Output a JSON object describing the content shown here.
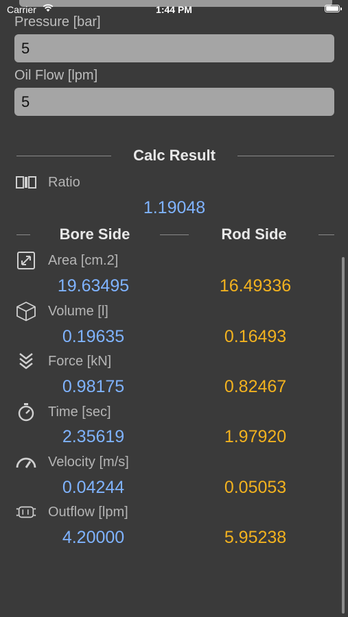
{
  "status": {
    "carrier": "Carrier",
    "time": "1:44 PM"
  },
  "inputs": {
    "pressure_label": "Pressure [bar]",
    "pressure_value": "5",
    "oilflow_label": "Oil Flow [lpm]",
    "oilflow_value": "5"
  },
  "result": {
    "title": "Calc Result",
    "ratio_label": "Ratio",
    "ratio_value": "1.19048",
    "bore_header": "Bore Side",
    "rod_header": "Rod Side"
  },
  "rows": [
    {
      "icon": "expand-arrows-icon",
      "label": "Area [cm.2]",
      "bore": "19.63495",
      "rod": "16.49336"
    },
    {
      "icon": "cube-icon",
      "label": "Volume  [l]",
      "bore": "0.19635",
      "rod": "0.16493"
    },
    {
      "icon": "triple-chevron-down-icon",
      "label": "Force [kN]",
      "bore": "0.98175",
      "rod": "0.82467"
    },
    {
      "icon": "stopwatch-icon",
      "label": "Time [sec]",
      "bore": "2.35619",
      "rod": "1.97920"
    },
    {
      "icon": "speedometer-icon",
      "label": "Velocity [m/s]",
      "bore": "0.04244",
      "rod": "0.05053"
    },
    {
      "icon": "cylinder-icon",
      "label": "Outflow [lpm]",
      "bore": "4.20000",
      "rod": "5.95238"
    }
  ],
  "colors": {
    "background": "#3a3a3a",
    "bore_value": "#7fb3ff",
    "rod_value": "#f2b21f",
    "field": "#a5a5a5"
  }
}
